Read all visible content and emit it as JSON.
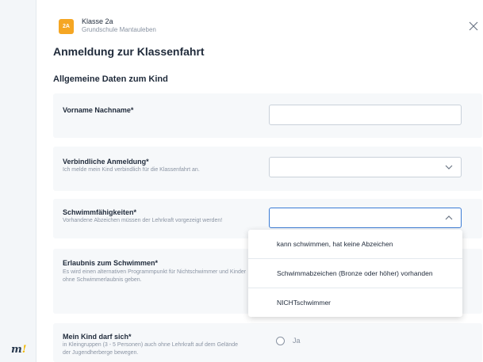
{
  "header": {
    "badge": "2A",
    "class_name": "Klasse 2a",
    "school": "Grundschule Mantauleben",
    "title": "Anmeldung zur Klassenfahrt",
    "section": "Allgemeine Daten zum Kind"
  },
  "fields": {
    "name": {
      "label": "Vorname Nachname*",
      "value": ""
    },
    "binding": {
      "label": "Verbindliche Anmeldung*",
      "hint": "Ich melde mein Kind verbindlich für die Klassenfahrt an.",
      "value": ""
    },
    "swim": {
      "label": "Schwimmfähigkeiten*",
      "hint": "Vorhandene Abzeichen müssen der Lehrkraft vorgezeigt werden!",
      "value": ""
    },
    "permission": {
      "label": "Erlaubnis zum Schwimmen*",
      "hint": "Es wird einen alternativen Programmpunkt für Nichtschwimmer und Kinder ohne Schwimmerlaubnis geben."
    },
    "free_move": {
      "label": "Mein Kind darf sich*",
      "hint": "in Kleingruppen (3 - 5 Personen) auch ohne Lehrkraft auf dem Gelände der Jugendherberge bewegen.",
      "option_yes": "Ja"
    }
  },
  "dropdown_options": [
    "kann schwimmen, hat keine Abzeichen",
    "Schwimmabzeichen (Bronze oder höher) vorhanden",
    "NICHTschwimmer"
  ],
  "logo": {
    "text": "m",
    "mark": "!"
  },
  "colors": {
    "accent": "#3a7bd5",
    "badge": "#f5a623",
    "card_bg": "#f6f8fa"
  }
}
